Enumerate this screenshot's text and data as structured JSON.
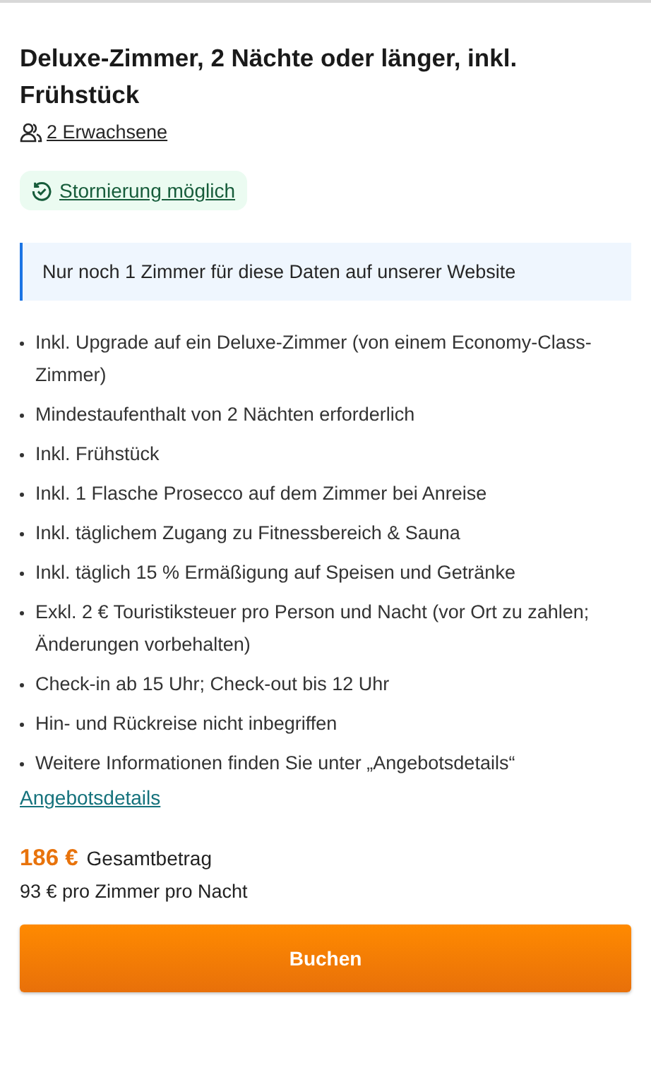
{
  "title": "Deluxe-Zimmer, 2 Nächte oder länger, inkl. Frühstück",
  "guests": "2 Erwachsene",
  "cancellation_badge": "Stornierung möglich",
  "availability_notice": "Nur noch 1 Zimmer für diese Daten auf unserer Website",
  "features": [
    "Inkl. Upgrade auf ein Deluxe-Zimmer (von einem Economy-Class-Zimmer)",
    "Mindestaufenthalt von 2 Nächten erforderlich",
    "Inkl. Frühstück",
    "Inkl. 1 Flasche Prosecco auf dem Zimmer bei Anreise",
    "Inkl. täglichem Zugang zu Fitnessbereich & Sauna",
    "Inkl. täglich 15 % Ermäßigung auf Speisen und Getränke",
    "Exkl. 2 € Touristiksteuer pro Person und Nacht (vor Ort zu zahlen; Änderungen vorbehalten)",
    "Check-in ab 15 Uhr; Check-out bis 12 Uhr",
    "Hin- und Rückreise nicht inbegriffen",
    "Weitere Informationen finden Sie unter „Angebotsdetails“"
  ],
  "details_link": "Angebotsdetails",
  "price": {
    "total": "186 €",
    "total_label": "Gesamtbetrag",
    "per_night": "93 € pro Zimmer pro Nacht"
  },
  "book_button": "Buchen"
}
